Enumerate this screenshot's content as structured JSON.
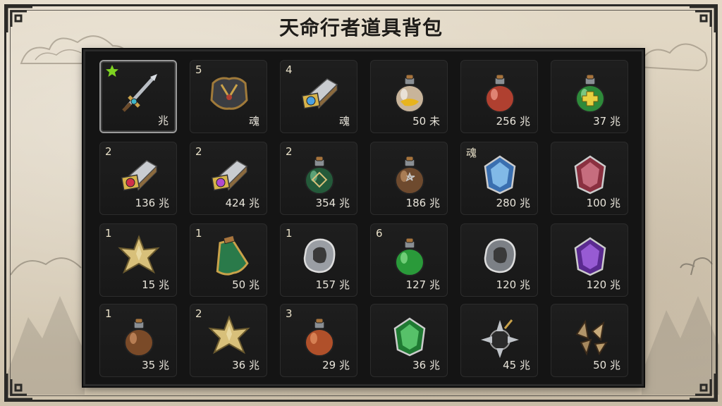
{
  "title": "天命行者道具背包",
  "colors": {
    "panel_bg": "#141414",
    "slot_bg": "#1c1c1c",
    "selected_border": "#9a9a9a",
    "star_green": "#7ed321"
  },
  "inventory": {
    "rows": [
      [
        {
          "badge": "",
          "qty": "兆",
          "icon": "dagger-icon",
          "selected": true,
          "star": true
        },
        {
          "badge": "5",
          "qty": "魂",
          "icon": "armor-icon"
        },
        {
          "badge": "4",
          "qty": "魂",
          "icon": "blue-gem-ingot-icon"
        },
        {
          "badge": "",
          "qty": "50 未",
          "icon": "gold-potion-icon"
        },
        {
          "badge": "",
          "qty": "256 兆",
          "icon": "red-potion-icon"
        },
        {
          "badge": "",
          "qty": "37 兆",
          "icon": "green-cross-potion-icon"
        }
      ],
      [
        {
          "badge": "2",
          "qty": "136 兆",
          "icon": "red-gem-ingot-icon"
        },
        {
          "badge": "2",
          "qty": "424 兆",
          "icon": "purple-gem-ingot-icon"
        },
        {
          "badge": "2",
          "qty": "354 兆",
          "icon": "green-rune-potion-icon"
        },
        {
          "badge": "",
          "qty": "186 兆",
          "icon": "brown-rune-potion-icon"
        },
        {
          "badge": "魂",
          "qty": "280 兆",
          "icon": "blue-crystal-icon"
        },
        {
          "badge": "",
          "qty": "100 兆",
          "icon": "red-crystal-icon"
        }
      ],
      [
        {
          "badge": "1",
          "qty": "15 兆",
          "icon": "gold-star-icon"
        },
        {
          "badge": "1",
          "qty": "50 兆",
          "icon": "green-flask-icon"
        },
        {
          "badge": "1",
          "qty": "157 兆",
          "icon": "silver-ore-icon"
        },
        {
          "badge": "6",
          "qty": "127 兆",
          "icon": "green-potion-icon"
        },
        {
          "badge": "",
          "qty": "120 兆",
          "icon": "grey-ore-icon"
        },
        {
          "badge": "",
          "qty": "120 兆",
          "icon": "purple-crystal-icon"
        }
      ],
      [
        {
          "badge": "1",
          "qty": "35 兆",
          "icon": "brown-potion-icon"
        },
        {
          "badge": "2",
          "qty": "36 兆",
          "icon": "gold-star-icon"
        },
        {
          "badge": "3",
          "qty": "29 兆",
          "icon": "orange-potion-icon"
        },
        {
          "badge": "",
          "qty": "36 兆",
          "icon": "green-crystal-icon"
        },
        {
          "badge": "",
          "qty": "45 兆",
          "icon": "spiked-bomb-icon"
        },
        {
          "badge": "",
          "qty": "50 兆",
          "icon": "shards-icon"
        }
      ]
    ]
  }
}
